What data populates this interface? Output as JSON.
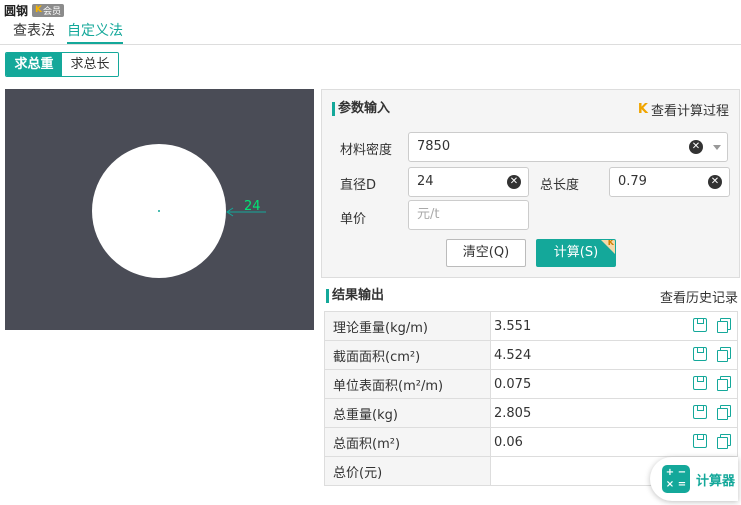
{
  "app": {
    "title": "圆钢",
    "vip_badge": "会员",
    "vip_badge_mark": "K"
  },
  "tabs": [
    {
      "label": "查表法"
    },
    {
      "label": "自定义法"
    }
  ],
  "mode_toggle": {
    "total_weight": "求总重",
    "total_length": "求总长"
  },
  "preview": {
    "dimension_label": "24"
  },
  "params": {
    "heading": "参数输入",
    "calc_process_label": "查看计算过程",
    "density": {
      "label": "材料密度",
      "value": "7850"
    },
    "diameter": {
      "label": "直径D",
      "value": "24"
    },
    "total_length": {
      "label": "总长度",
      "value": "0.79"
    },
    "unit_price": {
      "label": "单价",
      "value": "",
      "placeholder": "元/t"
    },
    "clear_button": "清空(Q)",
    "calc_button": "计算(S)"
  },
  "results": {
    "heading": "结果输出",
    "history_label": "查看历史记录",
    "rows": [
      {
        "label": "理论重量(kg/m)",
        "value": "3.551"
      },
      {
        "label": "截面面积(cm²)",
        "value": "4.524"
      },
      {
        "label": "单位表面积(m²/m)",
        "value": "0.075"
      },
      {
        "label": "总重量(kg)",
        "value": "2.805"
      },
      {
        "label": "总面积(m²)",
        "value": "0.06"
      },
      {
        "label": "总价(元)",
        "value": ""
      }
    ]
  },
  "calculator_fab": {
    "label": "计算器"
  },
  "colors": {
    "accent": "#14a89a",
    "preview_bg": "#4a4c56",
    "dimension": "#00e676"
  }
}
